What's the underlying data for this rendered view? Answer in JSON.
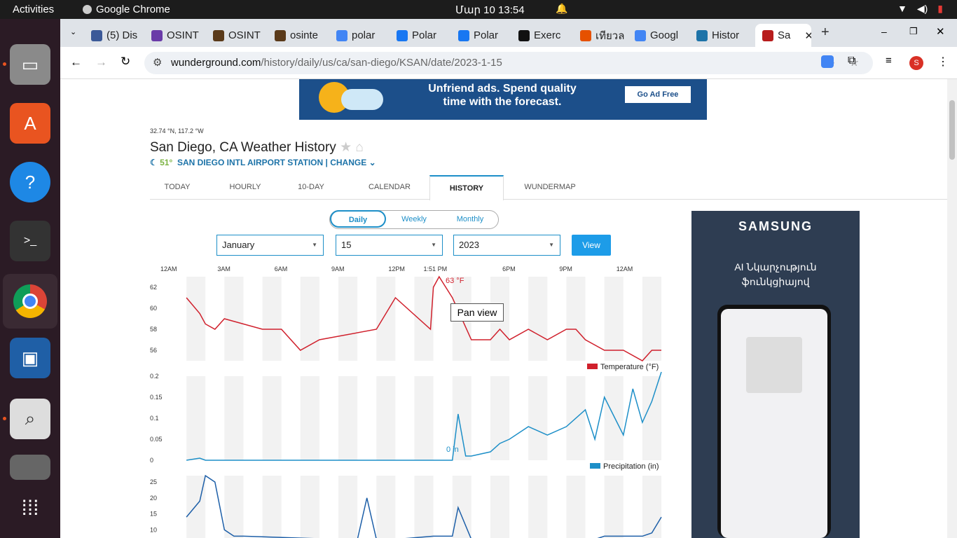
{
  "system": {
    "activities": "Activities",
    "app": "Google Chrome",
    "clock": "Մար 10  13:54"
  },
  "tabs": [
    {
      "label": "(5) Dis",
      "color": "#3b5998"
    },
    {
      "label": "OSINT",
      "color": "#6a3ba8"
    },
    {
      "label": "OSINT",
      "color": "#5a3a1a"
    },
    {
      "label": "osinte",
      "color": "#5a3a1a"
    },
    {
      "label": "polar",
      "color": "#4285f4"
    },
    {
      "label": "Polar",
      "color": "#1877f2"
    },
    {
      "label": "Polar",
      "color": "#1877f2"
    },
    {
      "label": "Exerc",
      "color": "#111111"
    },
    {
      "label": "เทียวล",
      "color": "#e65100"
    },
    {
      "label": "Googl",
      "color": "#4285f4"
    },
    {
      "label": "Histor",
      "color": "#1d73a8"
    },
    {
      "label": "Sa",
      "color": "#b71c1c"
    }
  ],
  "address": {
    "host": "wunderground.com",
    "path": "/history/daily/us/ca/san-diego/KSAN/date/2023-1-15"
  },
  "ad_top": {
    "text": "Unfriend ads. Spend quality time with the forecast.",
    "button": "Go Ad Free"
  },
  "location": {
    "coords": "32.74 °N, 117.2 °W",
    "title": "San Diego, CA Weather History",
    "temp": "51°",
    "station": "SAN DIEGO INTL AIRPORT STATION",
    "change": "CHANGE"
  },
  "nav": [
    "TODAY",
    "HOURLY",
    "10-DAY",
    "CALENDAR",
    "HISTORY",
    "WUNDERMAP"
  ],
  "period": [
    "Daily",
    "Weekly",
    "Monthly"
  ],
  "selects": {
    "month": "January",
    "day": "15",
    "year": "2023",
    "view": "View"
  },
  "tooltip": "Pan view",
  "ad_side": {
    "brand": "SAMSUNG",
    "caption": "AI Նկարչություն ֆունկցիայով"
  },
  "chart_data": [
    {
      "type": "line",
      "title": "",
      "legend": "Temperature (°F)",
      "color": "#d0202c",
      "xticks": [
        "12AM",
        "3AM",
        "6AM",
        "9AM",
        "12PM",
        "1:51 PM",
        "6PM",
        "9PM",
        "12AM"
      ],
      "ylim": [
        55,
        63
      ],
      "yticks": [
        56,
        58,
        60,
        62
      ],
      "annotation": "63 °F",
      "x": [
        1,
        1.7,
        2,
        2.5,
        3,
        5,
        6,
        7,
        8,
        11,
        12,
        13.85,
        14,
        14.3,
        15,
        16,
        17,
        17.5,
        18,
        19,
        20,
        21,
        21.5,
        22,
        23,
        24,
        25,
        25.5,
        26
      ],
      "y": [
        61,
        59.5,
        58.5,
        58,
        59,
        58,
        58,
        56,
        57,
        58,
        61,
        58,
        62,
        63,
        61,
        57,
        57,
        58,
        57,
        58,
        57,
        58,
        58,
        57,
        56,
        56,
        55,
        56,
        56
      ]
    },
    {
      "type": "line",
      "title": "",
      "legend": "Precipitation (in)",
      "color": "#1d8fc8",
      "ylim": [
        0,
        0.2
      ],
      "yticks": [
        0,
        0.05,
        0.1,
        0.15,
        0.2
      ],
      "annotation": "0 in",
      "x": [
        1,
        1.7,
        2,
        14,
        15,
        15.3,
        15.7,
        16,
        17,
        17.5,
        18,
        19,
        20,
        21,
        22,
        22.5,
        23,
        24,
        24.5,
        25,
        25.5,
        26
      ],
      "y": [
        0,
        0.005,
        0,
        0,
        0,
        0.11,
        0.01,
        0.01,
        0.02,
        0.04,
        0.05,
        0.08,
        0.06,
        0.08,
        0.12,
        0.05,
        0.15,
        0.06,
        0.17,
        0.09,
        0.14,
        0.21
      ]
    },
    {
      "type": "line",
      "title": "",
      "legend": "",
      "color": "#1d5fa8",
      "ylim": [
        5,
        27
      ],
      "yticks": [
        10,
        15,
        20,
        25
      ],
      "x": [
        1,
        1.7,
        2,
        2.5,
        3,
        3.5,
        4,
        9,
        10,
        10.5,
        11,
        12,
        14,
        15,
        15.3,
        16,
        17,
        18,
        19,
        20,
        21,
        22,
        22.5,
        23,
        24,
        25,
        25.5,
        26
      ],
      "y": [
        14,
        19,
        27,
        25,
        10,
        8,
        8,
        7,
        7,
        20,
        7,
        7,
        8,
        8,
        17,
        7,
        7,
        7,
        7,
        7,
        7,
        7,
        7,
        8,
        8,
        8,
        9,
        14
      ]
    }
  ]
}
